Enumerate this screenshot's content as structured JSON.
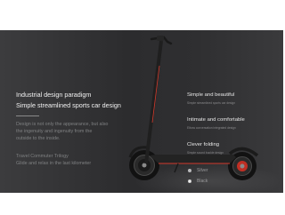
{
  "headline": {
    "line1": "Industrial design paradigm",
    "line2": "Simple streamlined sports car design"
  },
  "description": {
    "para1": [
      "Design is not only the appearance, but also",
      "the ingenuity and ingenuity from the",
      "outside to the inside."
    ],
    "para2": [
      "Travel Commuter Trilogy",
      "Glide and relax in the last kilometer"
    ]
  },
  "features": [
    {
      "title": "Simple and beautiful",
      "subtitle": "Simple streamlined sports car design"
    },
    {
      "title": "Intimate and comfortable",
      "subtitle": "Elbow conversation integrated design"
    },
    {
      "title": "Clever folding",
      "subtitle": "Simple sound buckle design"
    }
  ],
  "colors": {
    "options": [
      {
        "label": "Silver",
        "swatch": "#b9b9bb"
      },
      {
        "label": "Black",
        "swatch": "#f4f4f4"
      }
    ],
    "banner_background": "#2f2f31",
    "frame_accent": "#d23a2c"
  },
  "product_image": "electric-scooter"
}
